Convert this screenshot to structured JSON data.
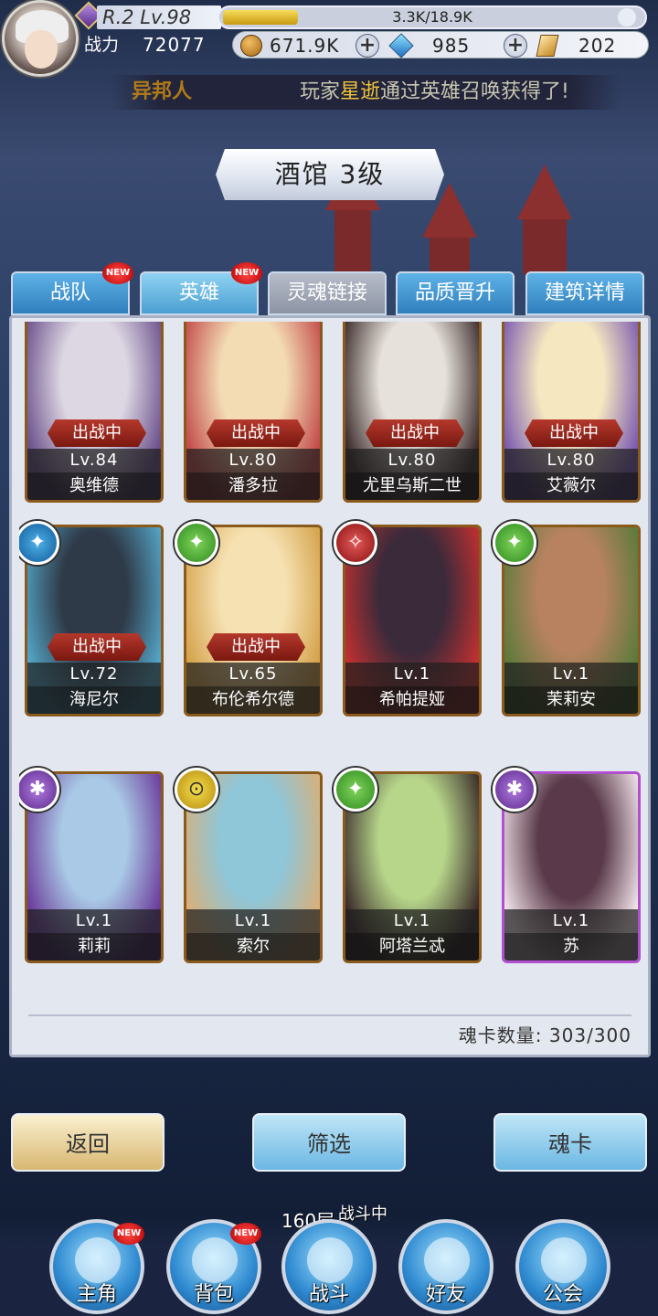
{
  "player": {
    "rank_level": "R.2 Lv.98",
    "exp_text": "3.3K/18.9K",
    "exp_fraction": 0.175,
    "power_label": "战力",
    "power_value": "72077"
  },
  "resources": {
    "gold": "671.9K",
    "diamond": "985",
    "card": "202"
  },
  "marquee": {
    "left_text": "异邦人",
    "right_prefix": "玩家",
    "right_highlight": "星逝",
    "right_suffix": "通过英雄召唤获得了!"
  },
  "title": "酒馆 3级",
  "tabs": [
    {
      "label": "战队",
      "new": "NEW"
    },
    {
      "label": "英雄",
      "new": "NEW"
    },
    {
      "label": "灵魂链接"
    },
    {
      "label": "品质晋升"
    },
    {
      "label": "建筑详情"
    }
  ],
  "heroes": [
    {
      "level": "Lv.84",
      "name": "奥维德",
      "status": "出战中"
    },
    {
      "level": "Lv.80",
      "name": "潘多拉",
      "status": "出战中"
    },
    {
      "level": "Lv.80",
      "name": "尤里乌斯二世",
      "status": "出战中"
    },
    {
      "level": "Lv.80",
      "name": "艾薇尔",
      "status": "出战中"
    },
    {
      "level": "Lv.72",
      "name": "海尼尔",
      "status": "出战中",
      "element": "blue"
    },
    {
      "level": "Lv.65",
      "name": "布伦希尔德",
      "status": "出战中",
      "element": "green"
    },
    {
      "level": "Lv.1",
      "name": "希帕提娅",
      "element": "red"
    },
    {
      "level": "Lv.1",
      "name": "茉莉安",
      "element": "green"
    },
    {
      "level": "Lv.1",
      "name": "莉莉",
      "element": "purple"
    },
    {
      "level": "Lv.1",
      "name": "索尔",
      "element": "yellow"
    },
    {
      "level": "Lv.1",
      "name": "阿塔兰忒",
      "element": "green"
    },
    {
      "level": "Lv.1",
      "name": "苏",
      "element": "purple"
    }
  ],
  "soul_card_count": "魂卡数量: 303/300",
  "buttons": {
    "back": "返回",
    "filter": "筛选",
    "soul_card": "魂卡"
  },
  "nav": {
    "floor": "160层",
    "fighting": "战斗中",
    "items": [
      {
        "label": "主角",
        "new": "NEW"
      },
      {
        "label": "背包",
        "new": "NEW"
      },
      {
        "label": "战斗"
      },
      {
        "label": "好友"
      },
      {
        "label": "公会"
      }
    ]
  },
  "colors": {
    "tab_blue": "#2f7fbe",
    "card_gold_border": "#8a5a1d",
    "card_purple_border": "#b14fd0",
    "battle_red": "#b5382c"
  }
}
